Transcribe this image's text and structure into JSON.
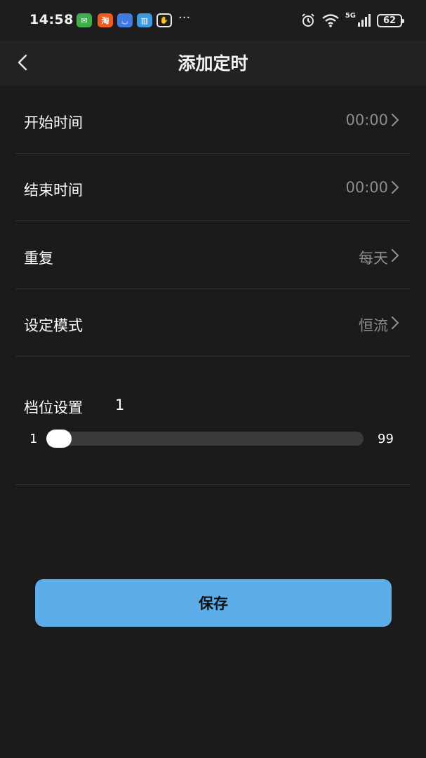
{
  "status_bar": {
    "time": "14:58",
    "more": "···",
    "signal_network": "5G",
    "battery_level": "62",
    "app_icons": [
      {
        "name": "wechat-icon",
        "glyph": "✉",
        "color": "#3db04c"
      },
      {
        "name": "taobao-icon",
        "glyph": "淘",
        "color": "#ef5a1d"
      },
      {
        "name": "store-icon",
        "glyph": "◡",
        "color": "#3f7be0"
      },
      {
        "name": "book-icon",
        "glyph": "▥",
        "color": "#3c9ae0"
      },
      {
        "name": "gesture-icon",
        "glyph": "✋",
        "color": "#1d1d1d"
      }
    ]
  },
  "header": {
    "title": "添加定时"
  },
  "settings": {
    "start_time": {
      "label": "开始时间",
      "value": "00:00"
    },
    "end_time": {
      "label": "结束时间",
      "value": "00:00"
    },
    "repeat": {
      "label": "重复",
      "value": "每天"
    },
    "mode": {
      "label": "设定模式",
      "value": "恒流"
    }
  },
  "level": {
    "label": "档位设置",
    "value": "1",
    "min": "1",
    "max": "99",
    "fraction": 0.0
  },
  "actions": {
    "save_label": "保存"
  },
  "colors": {
    "background": "#1b1b1b",
    "header": "#222222",
    "accent": "#5dade8",
    "secondary_text": "#8d8d8d"
  }
}
